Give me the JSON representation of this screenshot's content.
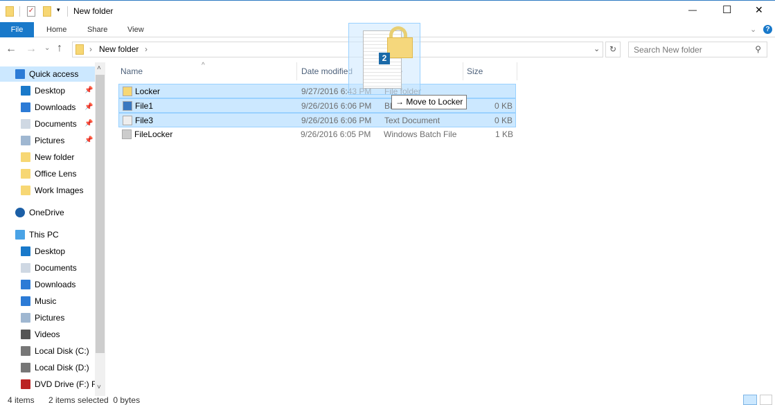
{
  "window": {
    "title": "New folder",
    "minimize": "—",
    "maximize": "☐",
    "close": "✕"
  },
  "ribbon": {
    "tabs": [
      {
        "label": "File"
      },
      {
        "label": "Home"
      },
      {
        "label": "Share"
      },
      {
        "label": "View"
      }
    ],
    "help": "?",
    "expand": "⌄"
  },
  "address": {
    "path": [
      "New folder"
    ],
    "search_placeholder": "Search New folder"
  },
  "sidebar": {
    "items": [
      {
        "label": "Quick access",
        "icon": "star-icon",
        "selected": true
      },
      {
        "label": "Desktop",
        "icon": "desktop-icon",
        "pinned": true
      },
      {
        "label": "Downloads",
        "icon": "download-icon",
        "pinned": true
      },
      {
        "label": "Documents",
        "icon": "documents-icon",
        "pinned": true
      },
      {
        "label": "Pictures",
        "icon": "pictures-icon",
        "pinned": true
      },
      {
        "label": "New folder",
        "icon": "folder-icon"
      },
      {
        "label": "Office Lens",
        "icon": "folder-sync-icon"
      },
      {
        "label": "Work Images",
        "icon": "folder-icon"
      },
      {
        "label": "OneDrive",
        "icon": "onedrive-icon"
      },
      {
        "label": "This PC",
        "icon": "pc-icon"
      },
      {
        "label": "Desktop",
        "icon": "desktop-icon"
      },
      {
        "label": "Documents",
        "icon": "documents-icon"
      },
      {
        "label": "Downloads",
        "icon": "download-icon"
      },
      {
        "label": "Music",
        "icon": "music-icon"
      },
      {
        "label": "Pictures",
        "icon": "pictures-icon"
      },
      {
        "label": "Videos",
        "icon": "videos-icon"
      },
      {
        "label": "Local Disk (C:)",
        "icon": "drive-icon"
      },
      {
        "label": "Local Disk (D:)",
        "icon": "drive-icon"
      },
      {
        "label": "DVD Drive (F:) Fl",
        "icon": "dvd-icon"
      }
    ]
  },
  "columns": {
    "name": "Name",
    "date": "Date modified",
    "type": "Type",
    "size": "Size"
  },
  "files": [
    {
      "name": "Locker",
      "date": "9/27/2016 6:43 PM",
      "type": "File folder",
      "size": "",
      "selected": true,
      "icon": "folder-icon"
    },
    {
      "name": "File1",
      "date": "9/26/2016 6:06 PM",
      "type": "BMP File",
      "size": "0 KB",
      "selected": true,
      "icon": "image-file-icon"
    },
    {
      "name": "File3",
      "date": "9/26/2016 6:06 PM",
      "type": "Text Document",
      "size": "0 KB",
      "selected": true,
      "icon": "text-file-icon"
    },
    {
      "name": "FileLocker",
      "date": "9/26/2016 6:05 PM",
      "type": "Windows Batch File",
      "size": "1 KB",
      "selected": false,
      "icon": "batch-file-icon"
    }
  ],
  "drag": {
    "count": "2",
    "tooltip": "Move to Locker",
    "arrow": "→"
  },
  "status": {
    "items": "4 items",
    "selected": "2 items selected  0 bytes"
  }
}
